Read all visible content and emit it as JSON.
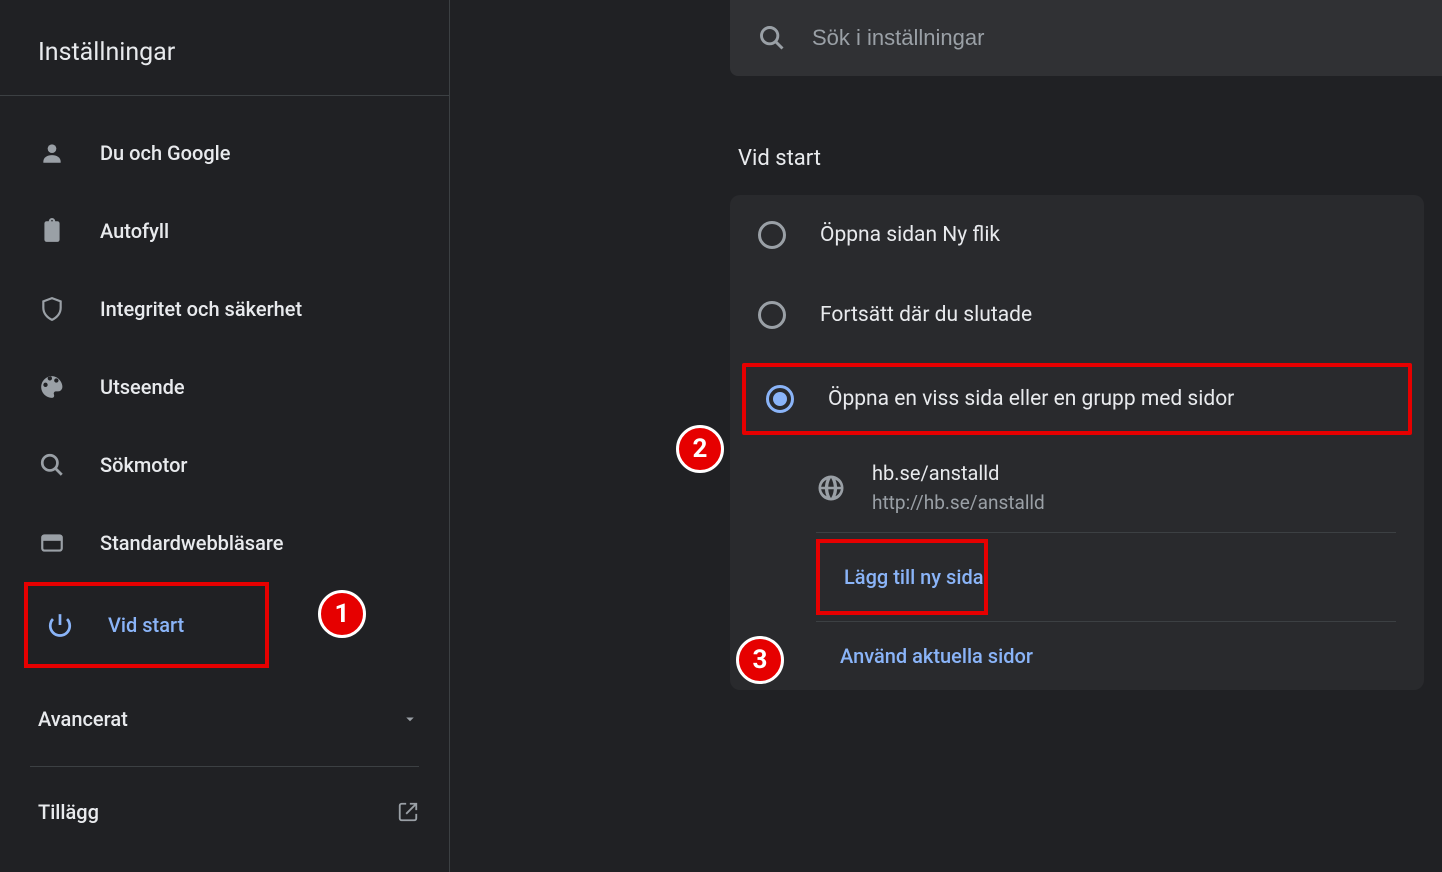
{
  "sidebar": {
    "title": "Inställningar",
    "items": [
      {
        "icon": "person-icon",
        "label": "Du och Google"
      },
      {
        "icon": "clipboard-icon",
        "label": "Autofyll"
      },
      {
        "icon": "shield-icon",
        "label": "Integritet och säkerhet"
      },
      {
        "icon": "palette-icon",
        "label": "Utseende"
      },
      {
        "icon": "search-icon",
        "label": "Sökmotor"
      },
      {
        "icon": "browser-icon",
        "label": "Standardwebbläsare"
      },
      {
        "icon": "power-icon",
        "label": "Vid start"
      }
    ],
    "advanced": "Avancerat",
    "extensions": "Tillägg"
  },
  "search": {
    "placeholder": "Sök i inställningar"
  },
  "section": {
    "title": "Vid start",
    "options": [
      {
        "label": "Öppna sidan Ny flik",
        "selected": false
      },
      {
        "label": "Fortsätt där du slutade",
        "selected": false
      },
      {
        "label": "Öppna en viss sida eller en grupp med sidor",
        "selected": true
      }
    ],
    "page": {
      "title": "hb.se/anstalld",
      "url": "http://hb.se/anstalld"
    },
    "add_page": "Lägg till ny sida",
    "use_current": "Använd aktuella sidor"
  },
  "annotations": {
    "b1": "1",
    "b2": "2",
    "b3": "3"
  }
}
